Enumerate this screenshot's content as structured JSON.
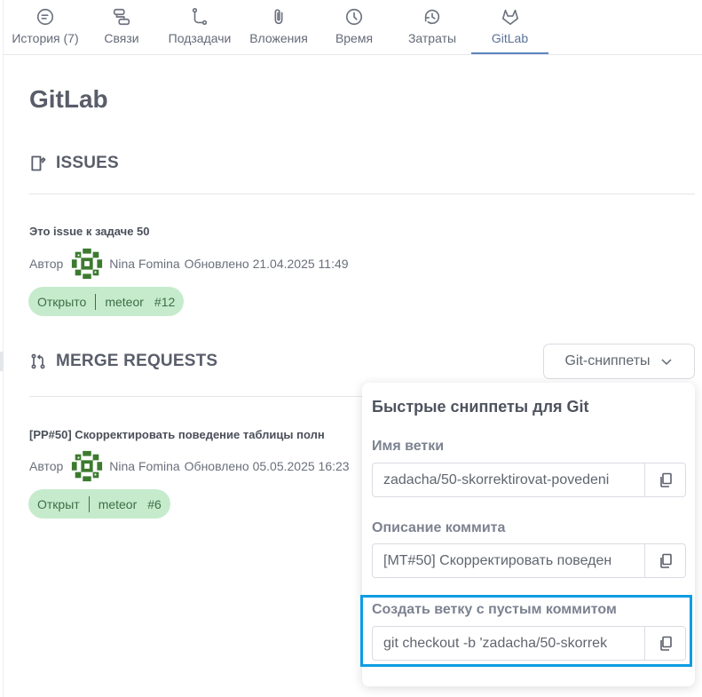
{
  "tabs": [
    {
      "label": "История (7)",
      "icon": "history-icon"
    },
    {
      "label": "Связи",
      "icon": "links-icon"
    },
    {
      "label": "Подзадачи",
      "icon": "subtasks-icon"
    },
    {
      "label": "Вложения",
      "icon": "paperclip-icon"
    },
    {
      "label": "Время",
      "icon": "clock-icon"
    },
    {
      "label": "Затраты",
      "icon": "costs-icon"
    },
    {
      "label": "GitLab",
      "icon": "gitlab-icon"
    }
  ],
  "active_tab": "GitLab",
  "page_title": "GitLab",
  "issues": {
    "heading": "ISSUES",
    "item": {
      "title": "Это issue к задаче 50",
      "author_label": "Автор",
      "author_name": "Nina Fomina",
      "updated": "Обновлено 21.04.2025 11:49",
      "status": "Открыто",
      "project": "meteor",
      "number": "#12"
    }
  },
  "merge_requests": {
    "heading": "MERGE REQUESTS",
    "snippets_button": "Git-сниппеты",
    "item": {
      "title": "[PP#50] Скорректировать поведение таблицы полн",
      "author_label": "Автор",
      "author_name": "Nina Fomina",
      "updated": "Обновлено 05.05.2025 16:23",
      "status": "Открыт",
      "project": "meteor",
      "number": "#6"
    }
  },
  "snippets_popover": {
    "title": "Быстрые сниппеты для Git",
    "fields": [
      {
        "label": "Имя ветки",
        "value": "zadacha/50-skorrektirovat-povedeni"
      },
      {
        "label": "Описание коммита",
        "value": "[MT#50] Скорректировать поведен"
      },
      {
        "label": "Создать ветку с пустым коммитом",
        "value": "git checkout -b 'zadacha/50-skorrek"
      }
    ]
  },
  "colors": {
    "accent": "#5d84c0",
    "badge_bg": "#c6ebcc",
    "badge_text": "#3c6e47",
    "highlight": "#0d9de3"
  }
}
